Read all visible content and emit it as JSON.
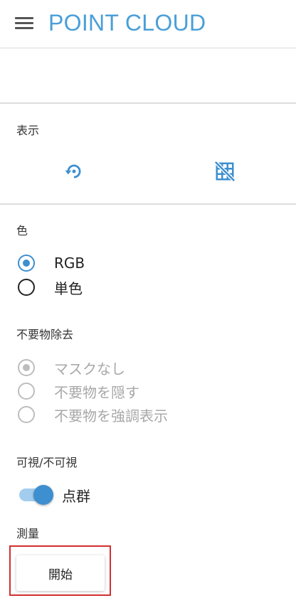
{
  "header": {
    "title": "POINT CLOUD",
    "menu_icon": "hamburger-menu-icon"
  },
  "display": {
    "label": "表示",
    "buttons": [
      {
        "icon": "reset-rotation-icon"
      },
      {
        "icon": "grid-off-icon"
      }
    ]
  },
  "color": {
    "label": "色",
    "options": [
      {
        "label": "RGB",
        "checked": true
      },
      {
        "label": "単色",
        "checked": false
      }
    ]
  },
  "removal": {
    "label": "不要物除去",
    "disabled": true,
    "options": [
      {
        "label": "マスクなし",
        "checked": true
      },
      {
        "label": "不要物を隠す",
        "checked": false
      },
      {
        "label": "不要物を強調表示",
        "checked": false
      }
    ]
  },
  "visibility": {
    "label": "可視/不可視",
    "toggle": {
      "label": "点群",
      "on": true
    }
  },
  "measurement": {
    "label": "測量",
    "start_button": "開始"
  },
  "colors": {
    "accent": "#3d8fcf",
    "title": "#4a9fd8",
    "highlight": "#d32f2f",
    "disabled": "#bdbdbd"
  }
}
